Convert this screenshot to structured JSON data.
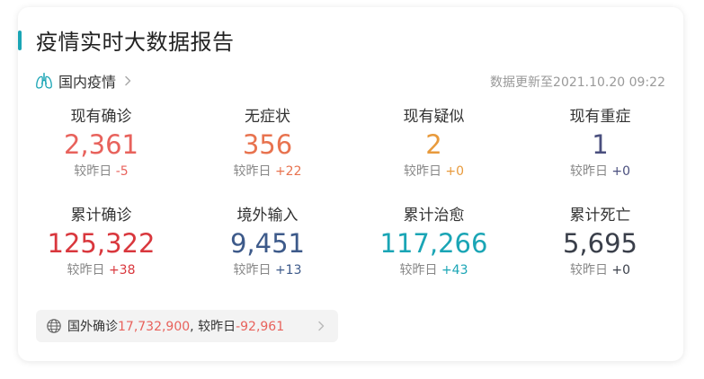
{
  "header": {
    "title": "疫情实时大数据报告",
    "accent_color": "#1aa5b5"
  },
  "region": {
    "icon": "lungs-icon",
    "label": "国内疫情",
    "update_text": "数据更新至2021.10.20 09:22"
  },
  "stats": [
    [
      {
        "label": "现有确诊",
        "value": "2,361",
        "delta_prefix": "较昨日",
        "delta": "-5",
        "value_color": "#e8625c",
        "delta_color": "#e8625c"
      },
      {
        "label": "无症状",
        "value": "356",
        "delta_prefix": "较昨日",
        "delta": "+22",
        "value_color": "#e8734f",
        "delta_color": "#e8734f"
      },
      {
        "label": "现有疑似",
        "value": "2",
        "delta_prefix": "较昨日",
        "delta": "+0",
        "value_color": "#e89a3c",
        "delta_color": "#e89a3c"
      },
      {
        "label": "现有重症",
        "value": "1",
        "delta_prefix": "较昨日",
        "delta": "+0",
        "value_color": "#4a4f7e",
        "delta_color": "#4a4f7e"
      }
    ],
    [
      {
        "label": "累计确诊",
        "value": "125,322",
        "delta_prefix": "较昨日",
        "delta": "+38",
        "value_color": "#d9373d",
        "delta_color": "#d9373d"
      },
      {
        "label": "境外输入",
        "value": "9,451",
        "delta_prefix": "较昨日",
        "delta": "+13",
        "value_color": "#3d5a8a",
        "delta_color": "#3d5a8a"
      },
      {
        "label": "累计治愈",
        "value": "117,266",
        "delta_prefix": "较昨日",
        "delta": "+43",
        "value_color": "#1aa5b5",
        "delta_color": "#1aa5b5"
      },
      {
        "label": "累计死亡",
        "value": "5,695",
        "delta_prefix": "较昨日",
        "delta": "+0",
        "value_color": "#3a3f4a",
        "delta_color": "#3a3f4a"
      }
    ]
  ],
  "foreign": {
    "icon": "globe-icon",
    "label": "国外确诊",
    "value": "17,732,900",
    "separator": ",",
    "delta_label": "较昨日",
    "delta": "-92,961",
    "highlight_color": "#e8625c"
  }
}
